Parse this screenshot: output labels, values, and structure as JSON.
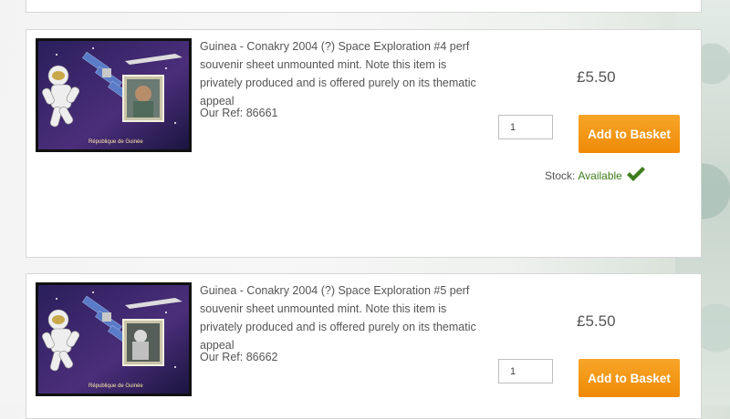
{
  "products": [
    {
      "description": "Guinea - Conakry 2004 (?) Space Exploration #4 perf souvenir sheet unmounted mint. Note this item is privately produced and is offered purely on its thematic appeal",
      "ref": "Our Ref: 86661",
      "price": "£5.50",
      "quantity": "1",
      "button_label": "Add to Basket",
      "stock_label": "Stock:",
      "stock_status": "Available",
      "stamp_caption": "République de Guinée"
    },
    {
      "description": "Guinea - Conakry 2004 (?) Space Exploration #5 perf souvenir sheet unmounted mint. Note this item is privately produced and is offered purely on its thematic appeal",
      "ref": "Our Ref: 86662",
      "price": "£5.50",
      "quantity": "1",
      "button_label": "Add to Basket",
      "stamp_caption": "République de Guinée"
    }
  ],
  "colors": {
    "button": "#f39512",
    "stock_available": "#3f7d1c",
    "check": "#3f7d1c"
  }
}
